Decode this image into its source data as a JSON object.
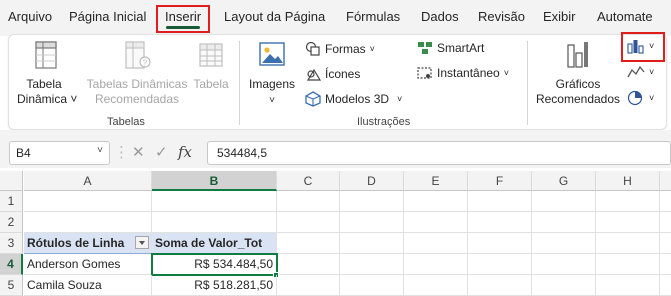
{
  "menu": {
    "tabs": [
      "Arquivo",
      "Página Inicial",
      "Inserir",
      "Layout da Página",
      "Fórmulas",
      "Dados",
      "Revisão",
      "Exibir",
      "Automate"
    ],
    "active_tab": "Inserir"
  },
  "ribbon": {
    "tabelas": {
      "group_label": "Tabelas",
      "tabela_dinamica": [
        "Tabela",
        "Dinâmica ˅"
      ],
      "tabelas_dinamicas_recomendadas": [
        "Tabelas Dinâmicas",
        "Recomendadas"
      ],
      "tabela": "Tabela"
    },
    "ilustracoes": {
      "group_label": "Ilustrações",
      "imagens": "Imagens",
      "formas": "Formas",
      "icones": "Ícones",
      "modelos_3d": "Modelos 3D",
      "smartart": "SmartArt",
      "instantaneo": "Instantâneo"
    },
    "graficos": {
      "graficos_recomendados": [
        "Gráficos",
        "Recomendados"
      ]
    }
  },
  "formula_bar": {
    "name_box": "B4",
    "fx_label": "fx",
    "formula_value": "534484,5"
  },
  "grid": {
    "columns": [
      "A",
      "B",
      "C",
      "D",
      "E",
      "F",
      "G",
      "H"
    ],
    "selected_column": "B",
    "rows": [
      "1",
      "2",
      "3",
      "4",
      "5"
    ],
    "selected_row": "4",
    "cells": {
      "A3": "Rótulos de Linha",
      "B3": "Soma de Valor_Tot",
      "A4": "Anderson Gomes",
      "B4": "R$ 534.484,50",
      "A5": "Camila Souza",
      "B5": "R$ 518.281,50"
    }
  },
  "colors": {
    "excel_green": "#107c41",
    "highlight_red": "#e01e1e",
    "pivot_header_blue": "#dae3f3"
  }
}
